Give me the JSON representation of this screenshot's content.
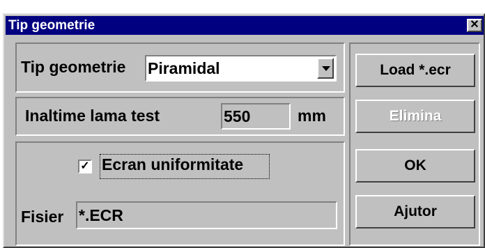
{
  "window": {
    "title": "Tip geometrie",
    "close_glyph": "✕"
  },
  "geometry": {
    "label": "Tip geometrie",
    "selected": "Piramidal"
  },
  "height": {
    "label": "Inaltime lama test",
    "value": "550",
    "unit": "mm"
  },
  "uniformity": {
    "checkbox_label": "Ecran uniformitate",
    "checked": true,
    "check_glyph": "✓"
  },
  "file": {
    "label": "Fisier",
    "value": "*.ECR"
  },
  "buttons": {
    "load": "Load *.ecr",
    "remove": "Elimina",
    "ok": "OK",
    "help": "Ajutor"
  }
}
